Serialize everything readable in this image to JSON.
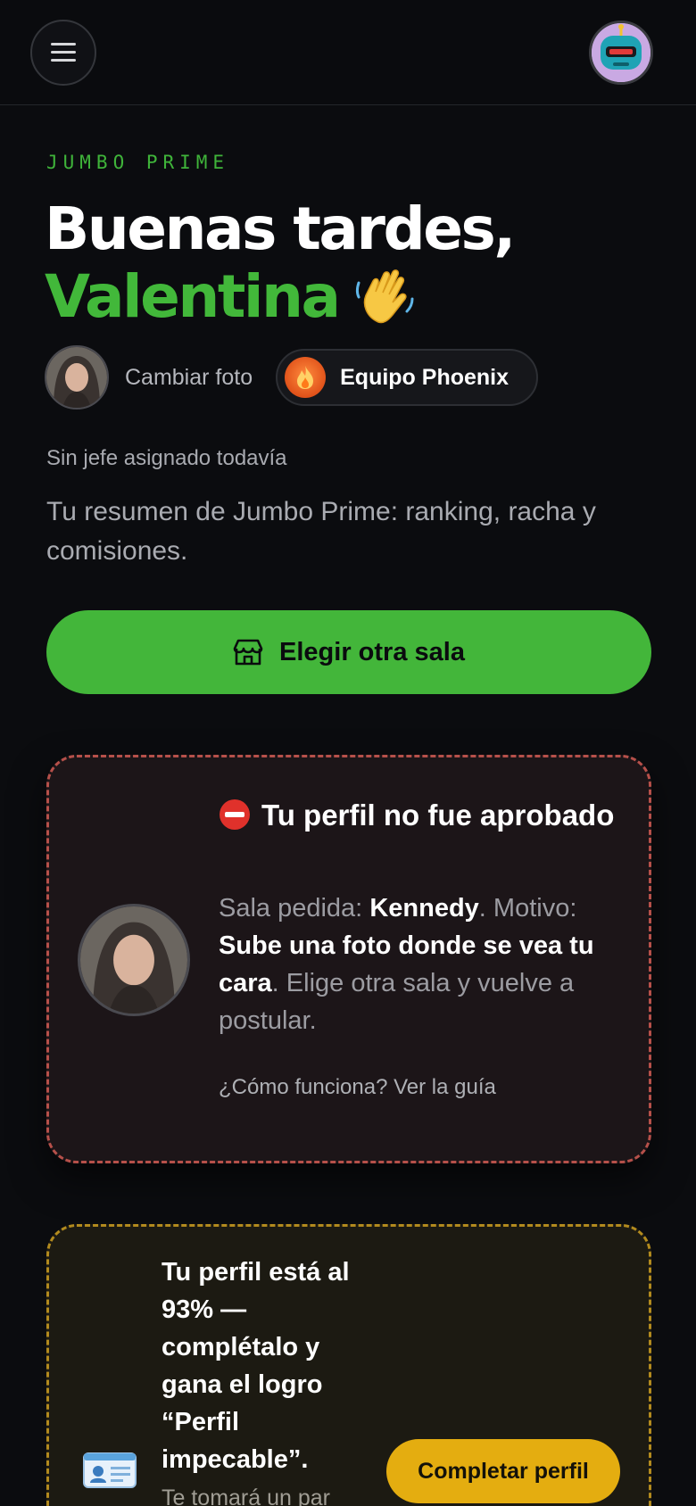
{
  "header": {
    "menu_icon": "hamburger-menu-icon",
    "avatar_icon": "robot-avatar-icon"
  },
  "hero": {
    "eyebrow": "JUMBO PRIME",
    "greeting": "Buenas tardes,",
    "name": "Valentina",
    "wave_icon": "waving-hand-icon"
  },
  "profile": {
    "change_photo_label": "Cambiar foto",
    "team_name": "Equipo Phoenix",
    "team_icon": "fire-icon",
    "boss_status": "Sin jefe asignado todavía",
    "summary": "Tu resumen de Jumbo Prime: ranking, racha y comisiones."
  },
  "actions": {
    "choose_room_label": "Elegir otra sala",
    "choose_room_icon": "store-icon"
  },
  "rejection_card": {
    "title": "Tu perfil no fue aprobado",
    "icon": "no-entry-icon",
    "room_prefix": "Sala pedida: ",
    "room_name": "Kennedy",
    "reason_prefix": ". Motivo: ",
    "reason": "Sube una foto donde se vea tu cara",
    "suffix": ". Elige otra sala y vuelve a postular.",
    "guide_link": "¿Cómo funciona? Ver la guía",
    "border_color": "#b6504a"
  },
  "completion_card": {
    "headline": "Tu perfil está al 93% — complétalo y gana el logro “Perfil impecable”.",
    "subtext": "Te tomará un par",
    "button_label": "Completar perfil",
    "icon": "id-card-icon",
    "completion_percent": 93,
    "accent": "#e4ad10"
  },
  "colors": {
    "brand_green": "#43b63a",
    "background": "#0b0c0f"
  }
}
